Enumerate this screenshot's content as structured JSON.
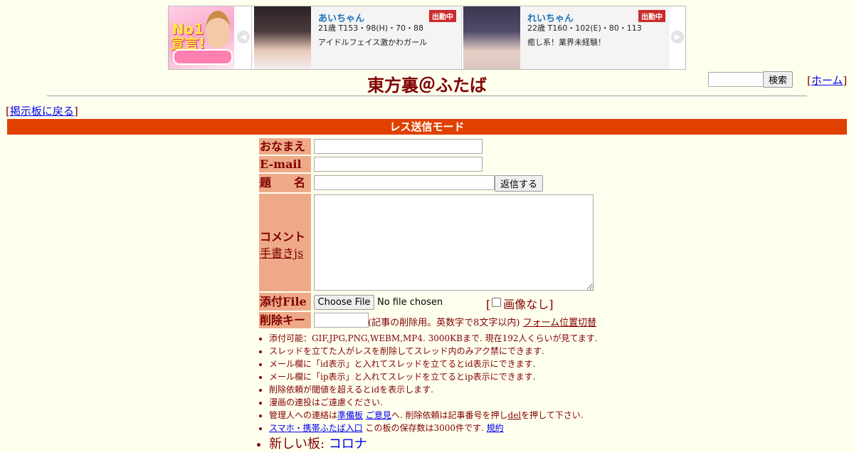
{
  "banner": {
    "ad_text": "No1宣言!",
    "cards": [
      {
        "name": "あいちゃん",
        "badge": "出勤中",
        "stats": "21歳 T153・98(H)・70・88",
        "catch": "アイドルフェイス激かわガール"
      },
      {
        "name": "れいちゃん",
        "badge": "出勤中",
        "stats": "22歳 T160・102(E)・80・113",
        "catch": "癒し系！業界未経験！"
      }
    ]
  },
  "header": {
    "title": "東方裏＠ふたば",
    "search_button": "検索",
    "home_open": "[",
    "home_link": "ホーム",
    "home_close": "]"
  },
  "nav": {
    "back_open": "[",
    "back_link": "掲示板に戻る",
    "back_close": "]"
  },
  "mode_bar": "レス送信モード",
  "form": {
    "name_label": "おなまえ",
    "email_label": "E-mail",
    "subject_label": "題　　名",
    "submit_button": "返信する",
    "comment_label": "コメント",
    "handwriting_link": "手書きjs",
    "file_label": "添付File",
    "file_button": "Choose File",
    "file_status": "No file chosen",
    "no_image_open": "[",
    "no_image_label": "画像なし",
    "no_image_close": "]",
    "delkey_label": "削除キー",
    "delkey_note": "(記事の削除用。英数字で8文字以内)",
    "form_position_link": "フォーム位置切替"
  },
  "rules": {
    "r1": "添付可能：GIF,JPG,PNG,WEBM,MP4. 3000KBまで. 現在192人くらいが見てます.",
    "r2": "スレッドを立てた人がレスを削除してスレッド内のみアク禁にできます.",
    "r3": "メール欄に「id表示」と入れてスレッドを立てるとid表示にできます.",
    "r4": "メール欄に「ip表示」と入れてスレッドを立てるとip表示にできます.",
    "r5": "削除依頼が閾値を超えるとidを表示します.",
    "r6": "漫画の連投はご遠慮ください.",
    "r7_pre": "管理人への連絡は",
    "r7_link1": "準備板",
    "r7_sp": " ",
    "r7_link2": "ご意見",
    "r7_mid": "へ. 削除依頼は記事番号を押し",
    "r7_del": "del",
    "r7_post": "を押して下さい.",
    "r8_link": "スマホ・携帯ふたば入口",
    "r8_mid": " この板の保存数は3000件です. ",
    "r8_link2": "規約",
    "r9_pre": "新しい板: ",
    "r9_link": "コロナ"
  },
  "colors": {
    "background": "#ffffee",
    "text": "#800000",
    "label_bg": "#eeaa88",
    "mode_bar": "#e04000",
    "link": "#0000ee"
  }
}
